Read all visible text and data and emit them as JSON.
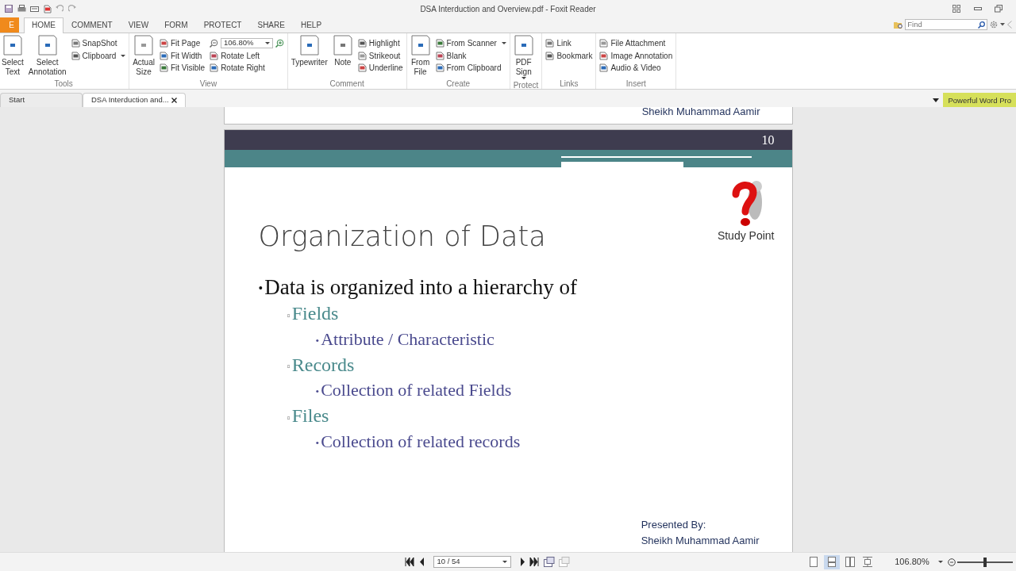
{
  "window": {
    "title": "DSA Interduction and Overview.pdf - Foxit Reader"
  },
  "file_tab": {
    "label": "E"
  },
  "menu_tabs": [
    {
      "label": "HOME",
      "selected": true
    },
    {
      "label": "COMMENT",
      "selected": false
    },
    {
      "label": "VIEW",
      "selected": false
    },
    {
      "label": "FORM",
      "selected": false
    },
    {
      "label": "PROTECT",
      "selected": false
    },
    {
      "label": "SHARE",
      "selected": false
    },
    {
      "label": "HELP",
      "selected": false
    }
  ],
  "find": {
    "placeholder": "Find"
  },
  "ribbon": [
    {
      "label": "Tools",
      "columns": [
        {
          "kind": "large",
          "label": "Select Text"
        },
        {
          "kind": "large",
          "label": "Select Annotation"
        },
        {
          "kind": "stack",
          "items": [
            {
              "label": "SnapShot",
              "dropdown": false
            },
            {
              "label": "Clipboard",
              "dropdown": true
            }
          ]
        }
      ]
    },
    {
      "label": "View",
      "columns": [
        {
          "kind": "large",
          "label": "Actual Size"
        },
        {
          "kind": "stack",
          "items": [
            {
              "label": "Fit Page",
              "dropdown": false
            },
            {
              "label": "Fit Width",
              "dropdown": false
            },
            {
              "label": "Fit Visible",
              "dropdown": false
            }
          ]
        },
        {
          "kind": "zoomstack",
          "zoom": "106.80%",
          "items": [
            {
              "label": "Rotate Left",
              "dropdown": false
            },
            {
              "label": "Rotate Right",
              "dropdown": false
            }
          ]
        }
      ]
    },
    {
      "label": "Comment",
      "columns": [
        {
          "kind": "large",
          "label": "Typewriter"
        },
        {
          "kind": "large",
          "label": "Note"
        },
        {
          "kind": "stack",
          "items": [
            {
              "label": "Highlight",
              "dropdown": false
            },
            {
              "label": "Strikeout",
              "dropdown": false
            },
            {
              "label": "Underline",
              "dropdown": false
            }
          ]
        }
      ]
    },
    {
      "label": "Create",
      "columns": [
        {
          "kind": "large",
          "label": "From File"
        },
        {
          "kind": "stack",
          "items": [
            {
              "label": "From Scanner",
              "dropdown": true
            },
            {
              "label": "Blank",
              "dropdown": false
            },
            {
              "label": "From Clipboard",
              "dropdown": false
            }
          ]
        }
      ]
    },
    {
      "label": "Protect",
      "columns": [
        {
          "kind": "large",
          "label": "PDF Sign",
          "dropdown": true
        }
      ]
    },
    {
      "label": "Links",
      "columns": [
        {
          "kind": "stack",
          "items": [
            {
              "label": "Link",
              "dropdown": false
            },
            {
              "label": "Bookmark",
              "dropdown": false
            }
          ]
        }
      ]
    },
    {
      "label": "Insert",
      "columns": [
        {
          "kind": "stack",
          "items": [
            {
              "label": "File Attachment",
              "dropdown": false
            },
            {
              "label": "Image Annotation",
              "dropdown": false
            },
            {
              "label": "Audio & Video",
              "dropdown": false
            }
          ]
        }
      ]
    }
  ],
  "doc_tabs": [
    {
      "label": "Start",
      "selected": false,
      "closable": false
    },
    {
      "label": "DSA Interduction and...",
      "selected": true,
      "closable": true
    }
  ],
  "promo": {
    "label": "Powerful Word Pro"
  },
  "previous_page": {
    "author": "Sheikh Muhammad Aamir"
  },
  "slide": {
    "page_number": "10",
    "title": "Organization of Data",
    "logo_caption": "Study Point",
    "bullets": [
      {
        "marker": "•",
        "text": "Data is organized into a hierarchy of",
        "children": [
          {
            "marker": "▫",
            "text": "Fields",
            "children": [
              {
                "marker": "•",
                "text": "Attribute / Characteristic"
              }
            ]
          },
          {
            "marker": "▫",
            "text": "Records",
            "children": [
              {
                "marker": "•",
                "text": "Collection of related Fields"
              }
            ]
          },
          {
            "marker": "▫",
            "text": "Files",
            "children": [
              {
                "marker": "•",
                "text": "Collection of related records"
              }
            ]
          }
        ]
      }
    ],
    "presented_by": "Presented By:",
    "author": "Sheikh Muhammad Aamir"
  },
  "status_bar": {
    "page": "10 / 54",
    "zoom": "106.80%",
    "view_modes": [
      {
        "selected": false
      },
      {
        "selected": true
      },
      {
        "selected": false
      },
      {
        "selected": false
      }
    ],
    "zoom_slider": {
      "level": 0.5
    }
  }
}
